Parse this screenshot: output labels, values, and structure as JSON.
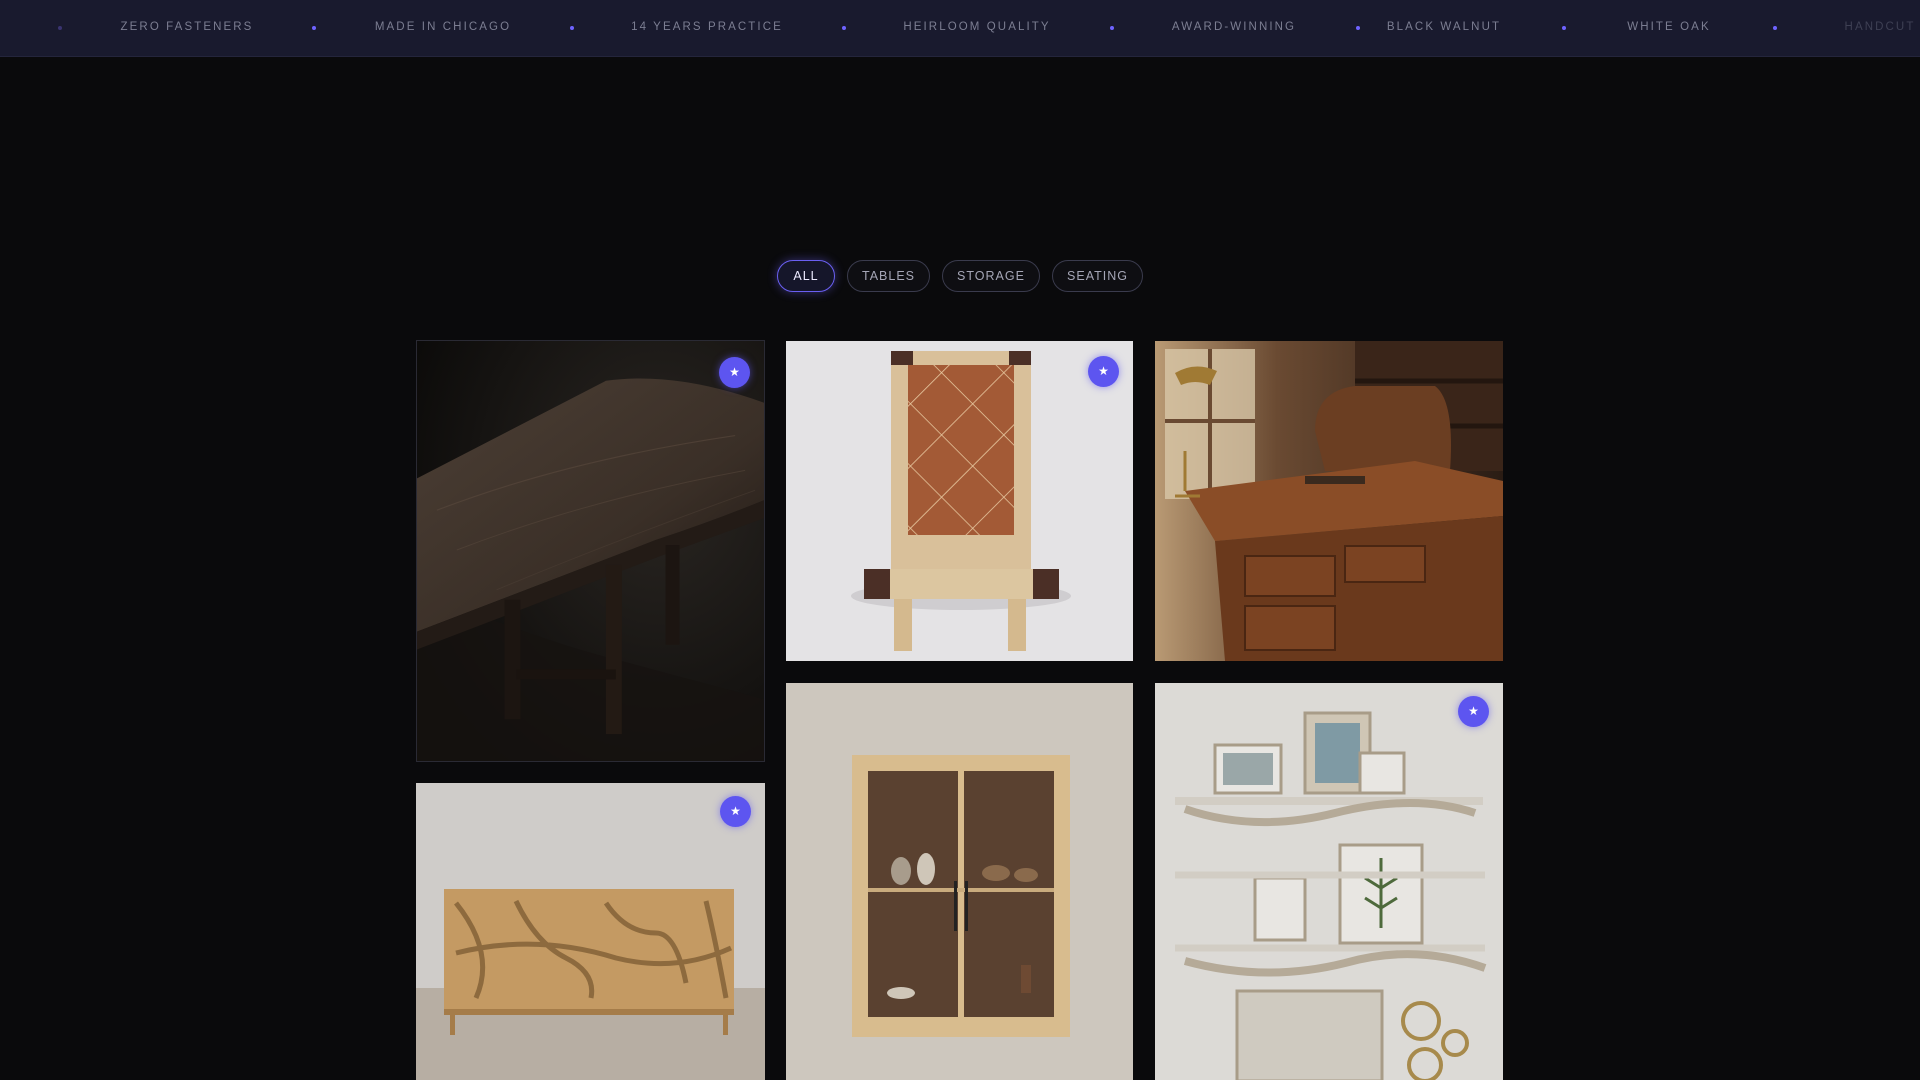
{
  "marquee": {
    "items": [
      "ZERO FASTENERS",
      "MADE IN CHICAGO",
      "14 YEARS PRACTICE",
      "HEIRLOOM QUALITY",
      "AWARD-WINNING",
      "BLACK WALNUT",
      "WHITE OAK",
      "HANDCUT"
    ],
    "accent": "#6f63ff"
  },
  "filters": {
    "items": [
      "ALL",
      "TABLES",
      "STORAGE",
      "SEATING"
    ],
    "active": "ALL"
  },
  "gallery": {
    "featured_badge": "★",
    "cards": [
      {
        "subject": "live-edge walnut dining table",
        "featured": true
      },
      {
        "subject": "ash bench with leather diamond inlay",
        "featured": true
      },
      {
        "subject": "traditional partners desk with brass lamp",
        "featured": false
      },
      {
        "subject": "oak sideboard with carved relief doors",
        "featured": true
      },
      {
        "subject": "wall-hung glass-door cabinet",
        "featured": false
      },
      {
        "subject": "driftwood branch wall shelves with frames",
        "featured": true
      }
    ]
  },
  "colors": {
    "background": "#0a0a0c",
    "marquee_bg": "#191a2e",
    "pill_active_border": "#6a5ff2",
    "badge": "#5d55f0"
  }
}
